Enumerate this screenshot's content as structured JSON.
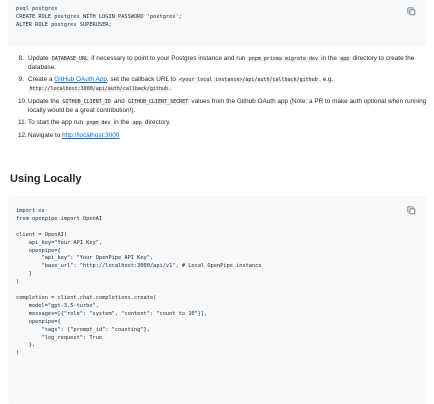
{
  "code_block_1": {
    "lines": [
      "psql postgres",
      "CREATE ROLE postgres WITH LOGIN PASSWORD 'postgres';",
      "ALTER ROLE postgres SUPERUSER;"
    ],
    "copy_icon": "copy-icon"
  },
  "steps": [
    {
      "num": "8.",
      "parts": [
        {
          "t": "Update "
        },
        {
          "c": "DATABASE_URL"
        },
        {
          "t": " if necessary to point to your Postgres instance and run "
        },
        {
          "c": "pnpm prisma migrate dev"
        },
        {
          "t": " in the "
        },
        {
          "c": "app"
        },
        {
          "t": " directory to create the database."
        }
      ]
    },
    {
      "num": "9.",
      "parts": [
        {
          "t": "Create a "
        },
        {
          "l": "GitHub OAuth App"
        },
        {
          "t": ", set the callback URL to "
        },
        {
          "c": "<your local instance>/api/auth/callback/github"
        },
        {
          "t": ", e.g. "
        },
        {
          "c": "http://localhost:3000/api/auth/callback/github"
        },
        {
          "t": "."
        }
      ]
    },
    {
      "num": "10.",
      "parts": [
        {
          "t": "Update the "
        },
        {
          "c": "GITHUB_CLIENT_ID"
        },
        {
          "t": " and "
        },
        {
          "c": "GITHUB_CLIENT_SECRET"
        },
        {
          "t": " values from the Github OAuth app (Note: a PR to make auth optional when running locally would be a great contribution!)."
        }
      ]
    },
    {
      "num": "11.",
      "parts": [
        {
          "t": "To start the app run "
        },
        {
          "c": "pnpm dev"
        },
        {
          "t": " in the "
        },
        {
          "c": "app"
        },
        {
          "t": " directory."
        }
      ]
    },
    {
      "num": "12.",
      "parts": [
        {
          "t": "Navigate to "
        },
        {
          "l": "http://localhost:3000"
        }
      ]
    }
  ],
  "section_heading": "Using Locally",
  "code_block_2": {
    "lines": [
      "import os",
      "from openpipe import OpenAI",
      "",
      "client = OpenAI(",
      "    api_key=\"Your API Key\",",
      "    openpipe={",
      "        \"api_key\": \"Your OpenPipe API Key\",",
      "        \"base_url\": \"http://localhost:3000/api/v1\", # Local OpenPipe instance",
      "    }",
      ")",
      "",
      "completion = client.chat.completions.create(",
      "    model=\"gpt-3.5-turbo\",",
      "    messages=[{\"role\": \"system\", \"content\": \"count to 10\"}],",
      "    openpipe={",
      "        \"tags\": {\"prompt_id\": \"counting\"},",
      "        \"log_request\": True",
      "    },",
      ")"
    ],
    "copy_icon": "copy-icon"
  }
}
